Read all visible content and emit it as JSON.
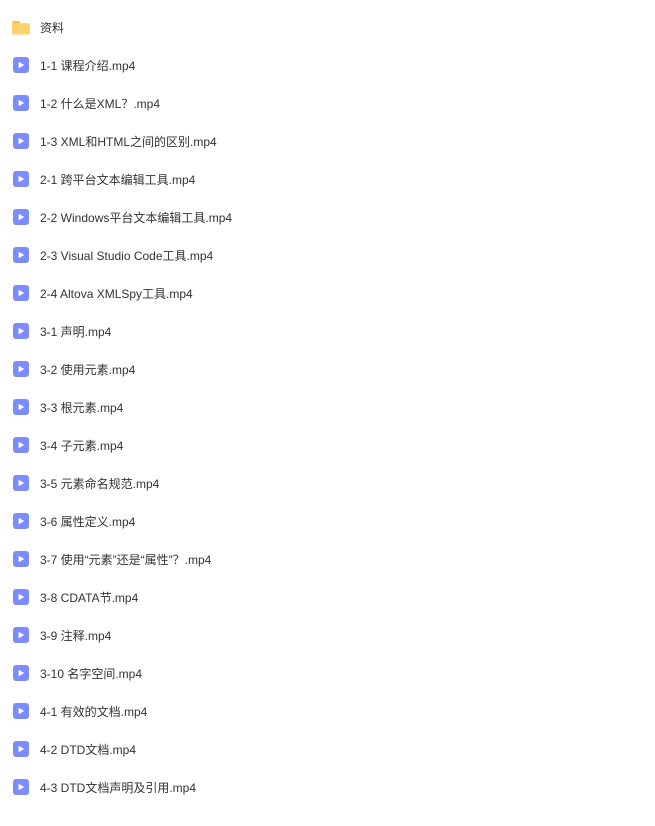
{
  "items": [
    {
      "type": "folder",
      "name": "资料"
    },
    {
      "type": "video",
      "name": "1-1 课程介绍.mp4"
    },
    {
      "type": "video",
      "name": "1-2 什么是XML？.mp4"
    },
    {
      "type": "video",
      "name": "1-3 XML和HTML之间的区别.mp4"
    },
    {
      "type": "video",
      "name": "2-1 跨平台文本编辑工具.mp4"
    },
    {
      "type": "video",
      "name": "2-2 Windows平台文本编辑工具.mp4"
    },
    {
      "type": "video",
      "name": "2-3 Visual Studio Code工具.mp4"
    },
    {
      "type": "video",
      "name": "2-4 Altova XMLSpy工具.mp4"
    },
    {
      "type": "video",
      "name": "3-1 声明.mp4"
    },
    {
      "type": "video",
      "name": "3-2 使用元素.mp4"
    },
    {
      "type": "video",
      "name": "3-3 根元素.mp4"
    },
    {
      "type": "video",
      "name": "3-4 子元素.mp4"
    },
    {
      "type": "video",
      "name": "3-5 元素命名规范.mp4"
    },
    {
      "type": "video",
      "name": "3-6 属性定义.mp4"
    },
    {
      "type": "video",
      "name": "3-7 使用“元素”还是“属性”？.mp4"
    },
    {
      "type": "video",
      "name": "3-8 CDATA节.mp4"
    },
    {
      "type": "video",
      "name": "3-9 注释.mp4"
    },
    {
      "type": "video",
      "name": "3-10 名字空间.mp4"
    },
    {
      "type": "video",
      "name": "4-1 有效的文档.mp4"
    },
    {
      "type": "video",
      "name": "4-2 DTD文档.mp4"
    },
    {
      "type": "video",
      "name": "4-3 DTD文档声明及引用.mp4"
    }
  ]
}
